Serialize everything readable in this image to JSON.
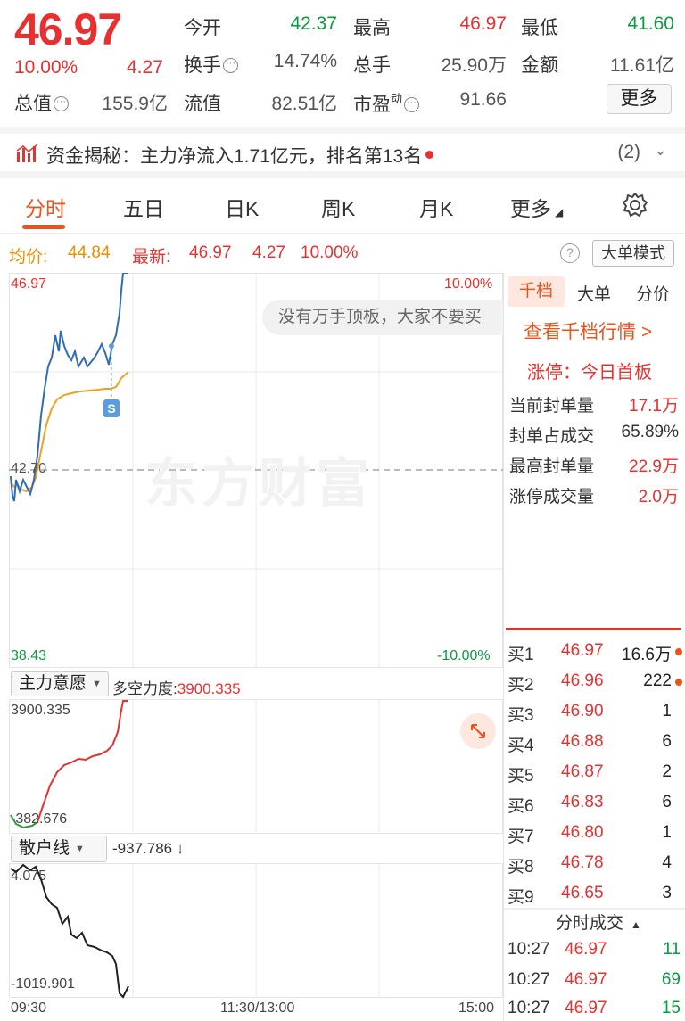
{
  "header": {
    "price": "46.97",
    "change_pct": "10.00%",
    "change_amt": "4.27",
    "open_label": "今开",
    "open": "42.37",
    "high_label": "最高",
    "high": "46.97",
    "low_label": "最低",
    "low": "41.60",
    "turnover_label": "换手",
    "turnover": "14.74%",
    "volume_label": "总手",
    "volume": "25.90万",
    "amount_label": "金额",
    "amount": "11.61亿",
    "mktcap_label": "总值",
    "mktcap": "155.9亿",
    "float_label": "流值",
    "float": "82.51亿",
    "pe_label": "市盈",
    "pe_sup": "动",
    "pe": "91.66",
    "more_label": "更多"
  },
  "fund_bar": {
    "text": "资金揭秘：主力净流入1.71亿元，排名第13名",
    "count": "(2)"
  },
  "tabs": [
    "分时",
    "五日",
    "日K",
    "周K",
    "月K",
    "更多"
  ],
  "avg_bar": {
    "avg_label": "均价:",
    "avg": "44.84",
    "latest_label": "最新:",
    "latest": "46.97",
    "latest_chg": "4.27",
    "latest_pct": "10.00%",
    "big_order_label": "大单模式"
  },
  "price_chart": {
    "top_price": "46.97",
    "top_pct": "10.00%",
    "mid_price": "42.70",
    "bottom_price": "38.43",
    "bottom_pct": "-10.00%",
    "notice": "没有万手顶板，大家不要买",
    "watermark": "东方财富",
    "s_marker": "S"
  },
  "main_force": {
    "selector": "主力意愿",
    "label": "多空力度:",
    "value": "3900.335",
    "top": "3900.335",
    "bottom": "-382.676"
  },
  "retail": {
    "selector": "散户线",
    "value": "-937.786 ↓",
    "top": "4.075",
    "bottom": "-1019.901"
  },
  "time_axis": [
    "09:30",
    "11:30/13:00",
    "15:00"
  ],
  "book": {
    "tabs": [
      "千档",
      "大单",
      "分价"
    ],
    "link": "查看千档行情 >",
    "limit_title": "涨停：今日首板",
    "stats": [
      {
        "label": "当前封单量",
        "value": "17.1万"
      },
      {
        "label": "封单占成交",
        "value": "65.89%"
      },
      {
        "label": "最高封单量",
        "value": "22.9万"
      },
      {
        "label": "涨停成交量",
        "value": "2.0万"
      }
    ],
    "bids": [
      {
        "label": "买1",
        "price": "46.97",
        "vol": "16.6万"
      },
      {
        "label": "买2",
        "price": "46.96",
        "vol": "222"
      },
      {
        "label": "买3",
        "price": "46.90",
        "vol": "1"
      },
      {
        "label": "买4",
        "price": "46.88",
        "vol": "6"
      },
      {
        "label": "买5",
        "price": "46.87",
        "vol": "2"
      },
      {
        "label": "买6",
        "price": "46.83",
        "vol": "6"
      },
      {
        "label": "买7",
        "price": "46.80",
        "vol": "1"
      },
      {
        "label": "买8",
        "price": "46.78",
        "vol": "4"
      },
      {
        "label": "买9",
        "price": "46.65",
        "vol": "3"
      }
    ],
    "ticks_title": "分时成交",
    "ticks": [
      {
        "time": "10:27",
        "price": "46.97",
        "vol": "11"
      },
      {
        "time": "10:27",
        "price": "46.97",
        "vol": "69"
      },
      {
        "time": "10:27",
        "price": "46.97",
        "vol": "15"
      }
    ]
  },
  "colors": {
    "up": "#e93030",
    "down": "#0a9a40",
    "accent": "#e8541e",
    "price_line": "#2f6db5",
    "avg_line": "#f0a020"
  }
}
